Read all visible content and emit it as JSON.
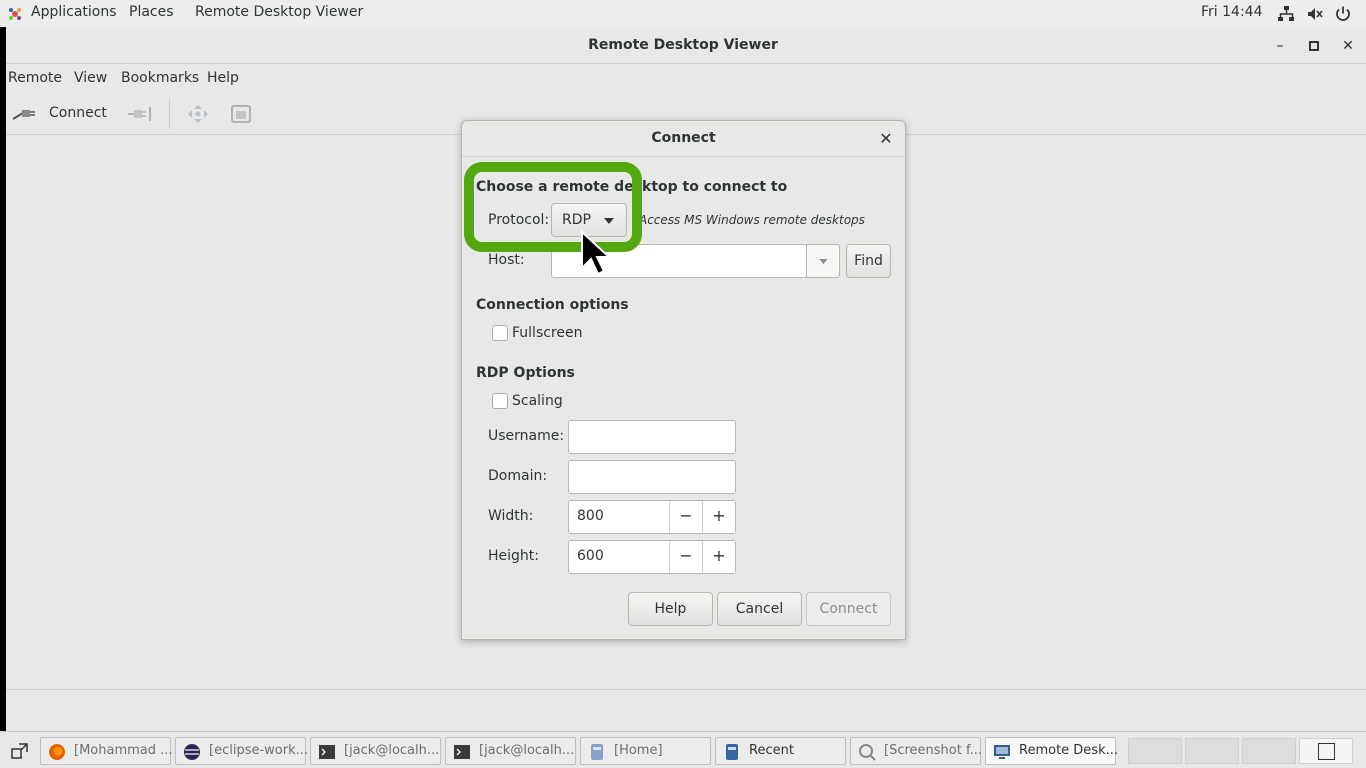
{
  "topbar": {
    "applications": "Applications",
    "places": "Places",
    "app_name": "Remote Desktop Viewer",
    "clock": "Fri 14:44",
    "icons": [
      "network-icon",
      "volume-muted-icon",
      "power-icon"
    ]
  },
  "window": {
    "title": "Remote Desktop Viewer",
    "menu": [
      "Remote",
      "View",
      "Bookmarks",
      "Help"
    ],
    "toolbar": {
      "connect_label": "Connect"
    }
  },
  "dialog": {
    "title": "Connect",
    "choose_heading": "Choose a remote desktop to connect to",
    "protocol_label": "Protocol:",
    "protocol_value": "RDP",
    "protocol_description": "Access MS Windows remote desktops",
    "host_label": "Host:",
    "host_value": "",
    "find_label": "Find",
    "connection_options_heading": "Connection options",
    "fullscreen_label": "Fullscreen",
    "fullscreen_checked": false,
    "rdp_options_heading": "RDP Options",
    "scaling_label": "Scaling",
    "scaling_checked": false,
    "username_label": "Username:",
    "username_value": "",
    "domain_label": "Domain:",
    "domain_value": "",
    "width_label": "Width:",
    "width_value": "800",
    "height_label": "Height:",
    "height_value": "600",
    "minus_symbol": "−",
    "plus_symbol": "+",
    "help_label": "Help",
    "cancel_label": "Cancel",
    "connect_label": "Connect"
  },
  "taskbar": {
    "tasks": [
      {
        "label": "[Mohammad ...",
        "icon": "firefox-icon",
        "active": false
      },
      {
        "label": "[eclipse-work...",
        "icon": "eclipse-icon",
        "active": false
      },
      {
        "label": "[jack@localh...",
        "icon": "terminal-icon",
        "active": false
      },
      {
        "label": "[jack@localh...",
        "icon": "terminal-icon",
        "active": false
      },
      {
        "label": "[Home]",
        "icon": "file-manager-icon",
        "active": false
      },
      {
        "label": "Recent",
        "icon": "file-manager-icon",
        "active": false
      },
      {
        "label": "[Screenshot f...",
        "icon": "screenshot-icon",
        "active": false
      },
      {
        "label": "Remote Desk...",
        "icon": "remote-desktop-icon",
        "active": true
      }
    ]
  },
  "colors": {
    "highlight": "#54a80f",
    "window_bg": "#e8e8e7",
    "text": "#2e3436"
  }
}
